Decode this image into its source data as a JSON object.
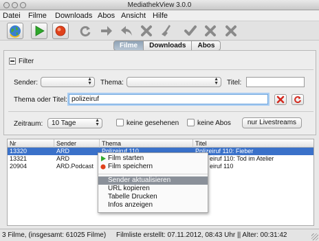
{
  "window": {
    "title": "MediathekView 3.0.0"
  },
  "menu": [
    "Datei",
    "Filme",
    "Downloads",
    "Abos",
    "Ansicht",
    "Hilfe"
  ],
  "toolbar": {
    "icons": [
      "globe-refresh-icon",
      "play-icon",
      "record-icon",
      "refresh-icon",
      "forward-icon",
      "back-icon",
      "delete-icon",
      "broom-icon",
      "check-icon",
      "delete-icon",
      "delete-icon"
    ]
  },
  "tabs": [
    {
      "label": "Filme",
      "active": true
    },
    {
      "label": "Downloads",
      "active": false
    },
    {
      "label": "Abos",
      "active": false
    }
  ],
  "filter": {
    "title": "Filter",
    "sender_label": "Sender:",
    "sender_value": "",
    "thema_label": "Thema:",
    "thema_value": "",
    "titel_label": "Titel:",
    "titel_value": "",
    "thema_oder_titel_label": "Thema oder Titel:",
    "thema_oder_titel_value": "polizeiruf",
    "zeitraum_label": "Zeitraum:",
    "zeitraum_value": "10 Tage",
    "keine_gesehenen_label": "keine gesehenen",
    "keine_gesehenen_checked": false,
    "keine_abos_label": "keine Abos",
    "keine_abos_checked": false,
    "livestreams_label": "nur Livestreams"
  },
  "table": {
    "columns": [
      "Nr",
      "Sender",
      "Thema",
      "Titel"
    ],
    "rows": [
      {
        "nr": "13320",
        "sender": "ARD",
        "thema": "Polizeiruf 110",
        "titel": "Polizeiruf 110: Fieber",
        "selected": true
      },
      {
        "nr": "13321",
        "sender": "ARD",
        "thema": "",
        "titel": "eiruf 110: Tod im Atelier",
        "selected": false
      },
      {
        "nr": "20904",
        "sender": "ARD.Podcast",
        "thema": "",
        "titel": "eiruf 110",
        "selected": false
      }
    ]
  },
  "context_menu": {
    "items": [
      {
        "label": "Film starten",
        "icon": "play-icon"
      },
      {
        "label": "Film speichern",
        "icon": "record-icon"
      },
      {
        "label": "Sender aktualisieren",
        "highlighted": true
      },
      {
        "label": "URL kopieren"
      },
      {
        "label": "Tabelle Drucken"
      },
      {
        "label": "Infos anzeigen"
      }
    ]
  },
  "status": {
    "left": "3 Filme, (insgesamt: 61025 Filme)",
    "right": "Filmliste erstellt: 07.11.2012, 08:43 Uhr  ||  Alter: 00:31:42"
  },
  "colors": {
    "selection": "#3a71c9",
    "menu_highlight": "#8a9099",
    "play": "#2ea82b",
    "record": "#e0421b",
    "delete_red": "#d42a1f"
  }
}
